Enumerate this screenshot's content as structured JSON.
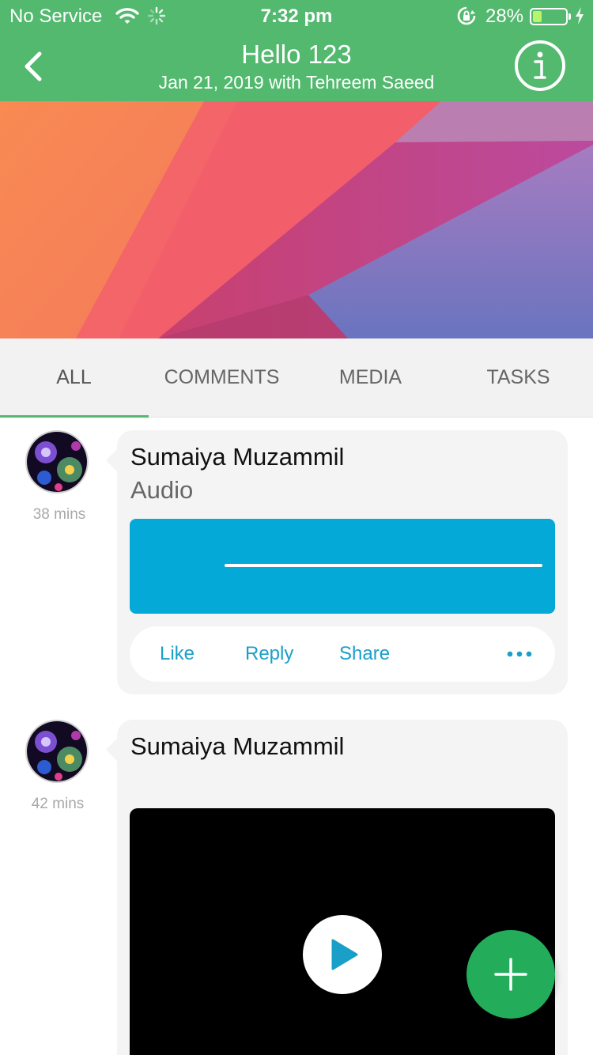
{
  "status_bar": {
    "carrier": "No Service",
    "time": "7:32 pm",
    "battery_percent": "28%",
    "battery_level": 0.28
  },
  "header": {
    "title": "Hello 123",
    "subtitle": "Jan 21, 2019 with Tehreem Saeed",
    "back_icon": "chevron-left-icon",
    "info_icon": "info-icon"
  },
  "tabs": [
    {
      "label": "ALL",
      "active": true
    },
    {
      "label": "COMMENTS",
      "active": false
    },
    {
      "label": "MEDIA",
      "active": false
    },
    {
      "label": "TASKS",
      "active": false
    }
  ],
  "posts": [
    {
      "author": "Sumaiya Muzammil",
      "type_label": "Audio",
      "time_ago": "38 mins",
      "actions": {
        "like": "Like",
        "reply": "Reply",
        "share": "Share"
      },
      "media": "audio"
    },
    {
      "author": "Sumaiya Muzammil",
      "type_label": "",
      "time_ago": "42 mins",
      "media": "video"
    }
  ],
  "fab_icon": "plus-icon",
  "colors": {
    "header": "#52b96e",
    "accent": "#1a9fc8",
    "audio_bg": "#04a9d7",
    "fab": "#23ad5b"
  }
}
